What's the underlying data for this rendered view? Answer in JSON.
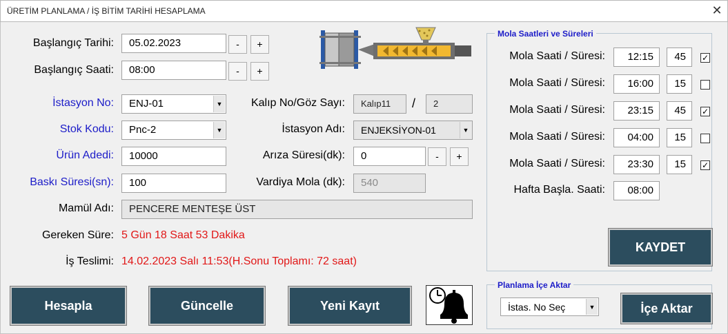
{
  "window": {
    "title": "ÜRETİM PLANLAMA / İŞ BİTİM TARİHİ HESAPLAMA",
    "close_glyph": "✕"
  },
  "form": {
    "start_date": {
      "label": "Başlangıç Tarihi:",
      "value": "05.02.2023"
    },
    "start_time": {
      "label": "Başlangıç Saati:",
      "value": "08:00"
    },
    "station_no": {
      "label": "İstasyon No:",
      "value": "ENJ-01"
    },
    "stock_code": {
      "label": "Stok Kodu:",
      "value": "Pnc-2"
    },
    "product_qty": {
      "label": "Ürün Adedi:",
      "value": "10000"
    },
    "press_time": {
      "label": "Baskı Süresi(sn):",
      "value": "100"
    },
    "mold": {
      "label": "Kalıp No/Göz Sayı:",
      "mold_no": "Kalıp11",
      "separator": "/",
      "cavity": "2"
    },
    "station_name": {
      "label": "İstasyon Adı:",
      "value": "ENJEKSİYON-01"
    },
    "fault_time": {
      "label": "Arıza Süresi(dk):",
      "value": "0"
    },
    "shift_break": {
      "label": "Vardiya Mola (dk):",
      "value": "540"
    },
    "product_name": {
      "label": "Mamül Adı:",
      "value": "PENCERE MENTEŞE ÜST"
    },
    "required_time": {
      "label": "Gereken Süre:",
      "value": "5 Gün 18 Saat 53 Dakika"
    },
    "delivery": {
      "label": "İş Teslimi:",
      "value": "14.02.2023 Salı 11:53(H.Sonu Toplamı: 72 saat)"
    },
    "minus": "-",
    "plus": "+"
  },
  "breaks": {
    "title": "Mola Saatleri ve Süreleri",
    "row_label": "Mola Saati / Süresi:",
    "rows": [
      {
        "time": "12:15",
        "duration": "45",
        "checked": true,
        "mark": "✓"
      },
      {
        "time": "16:00",
        "duration": "15",
        "checked": false,
        "mark": ""
      },
      {
        "time": "23:15",
        "duration": "45",
        "checked": true,
        "mark": "✓"
      },
      {
        "time": "04:00",
        "duration": "15",
        "checked": false,
        "mark": ""
      },
      {
        "time": "23:30",
        "duration": "15",
        "checked": true,
        "mark": "✓"
      }
    ],
    "week_start": {
      "label": "Hafta Başla. Saati:",
      "value": "08:00"
    },
    "save_label": "KAYDET"
  },
  "import": {
    "title": "Planlama İçe Aktar",
    "select_value": "İstas. No Seç",
    "button_label": "İçe Aktar"
  },
  "actions": {
    "calculate": "Hesapla",
    "update": "Güncelle",
    "new_record": "Yeni Kayıt"
  },
  "colors": {
    "button_bg": "#2c4d5e",
    "accent_blue": "#1c1cc8",
    "result_red": "#e11717"
  }
}
